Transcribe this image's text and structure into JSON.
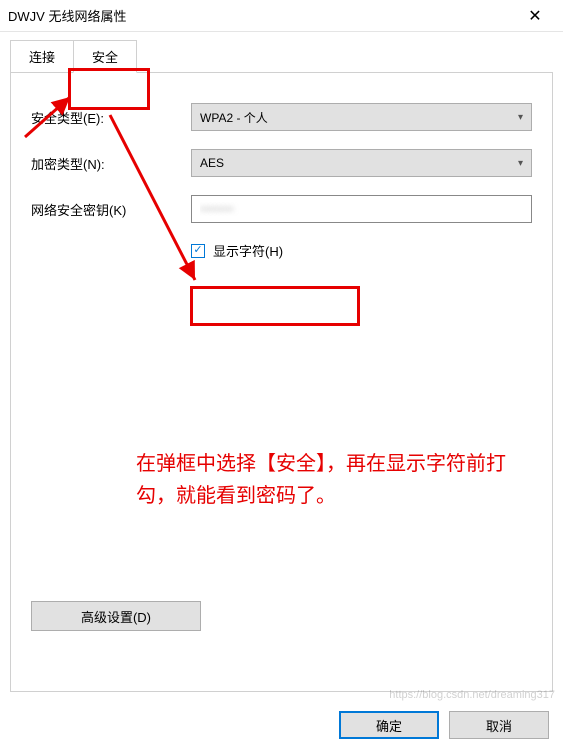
{
  "window": {
    "title": "DWJV 无线网络属性"
  },
  "tabs": {
    "connect": "连接",
    "security": "安全"
  },
  "form": {
    "security_type_label": "安全类型(E):",
    "security_type_value": "WPA2 - 个人",
    "encryption_label": "加密类型(N):",
    "encryption_value": "AES",
    "key_label": "网络安全密钥(K)",
    "key_value": "••••••••",
    "show_chars_label": "显示字符(H)"
  },
  "advanced_button": "高级设置(D)",
  "buttons": {
    "ok": "确定",
    "cancel": "取消"
  },
  "annotation": {
    "text": "在弹框中选择【安全】，再在显示字符前打勾，就能看到密码了。"
  },
  "watermark": "https://blog.csdn.net/dreaming317",
  "colors": {
    "accent": "#e60000",
    "primary": "#0078d7"
  }
}
